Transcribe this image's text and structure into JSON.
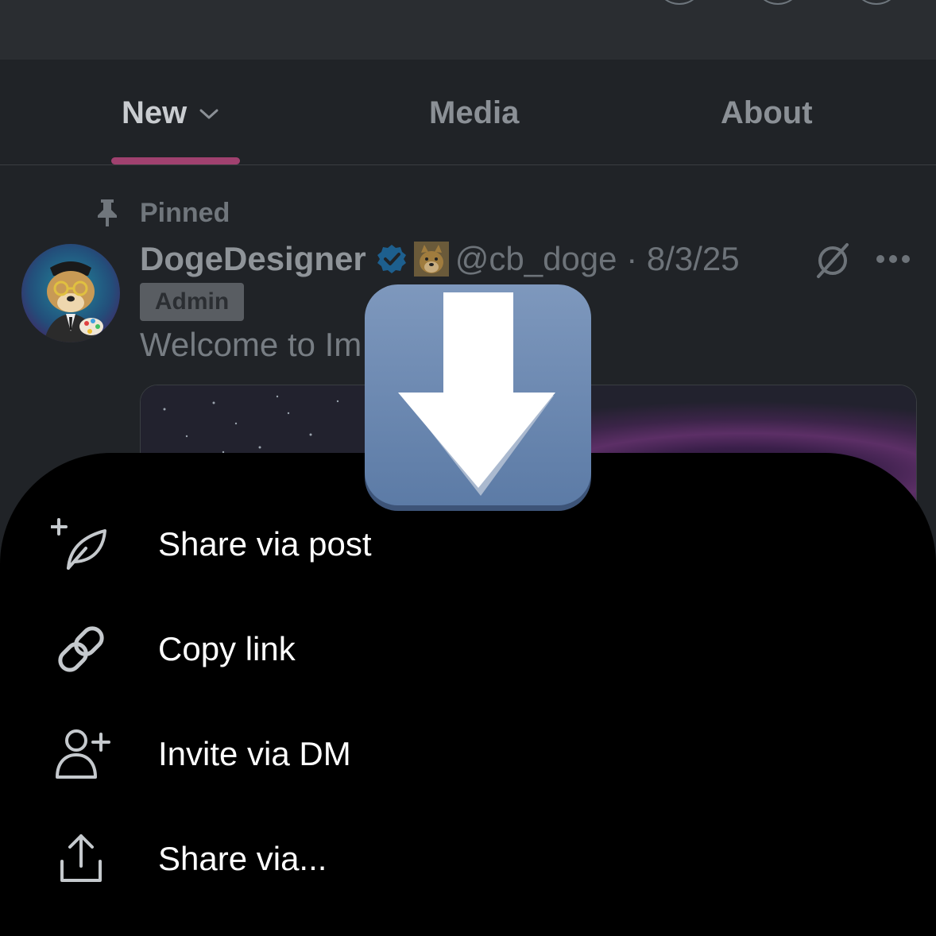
{
  "tabs": [
    {
      "label": "New",
      "active": true
    },
    {
      "label": "Media",
      "active": false
    },
    {
      "label": "About",
      "active": false
    }
  ],
  "pinned": {
    "label": "Pinned",
    "icon": "pin-icon"
  },
  "post": {
    "author": "DogeDesigner",
    "handle": "@cb_doge · 8/3/25",
    "badge": "Admin",
    "text": "Welcome to Im",
    "icons": [
      "verified-icon",
      "doge-emoji-icon",
      "grok-icon",
      "more-icon"
    ]
  },
  "share_menu": {
    "items": [
      {
        "label": "Share via post",
        "icon": "compose-post-icon"
      },
      {
        "label": "Copy link",
        "icon": "link-icon"
      },
      {
        "label": "Invite via DM",
        "icon": "add-user-icon"
      },
      {
        "label": "Share via...",
        "icon": "share-icon"
      }
    ]
  },
  "overlay": {
    "icon": "download-arrow-icon"
  },
  "colors": {
    "tab_indicator": "#a0416f",
    "sheet_background": "#000000",
    "page_background": "#202327",
    "verified_blue": "#1d9bf0",
    "download_badge": "#6f8cb4"
  }
}
